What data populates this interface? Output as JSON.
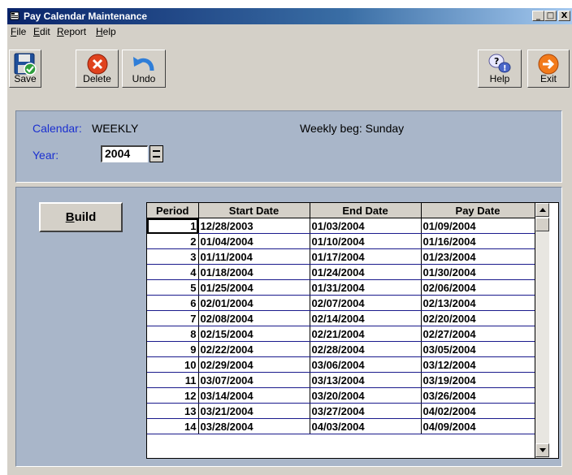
{
  "window": {
    "title": "Pay Calendar Maintenance",
    "controls": {
      "minimize": "_",
      "maximize": "□",
      "close": "X"
    }
  },
  "menu": [
    {
      "label": "File",
      "ul": "F",
      "rest": "ile"
    },
    {
      "label": "Edit",
      "ul": "E",
      "rest": "dit"
    },
    {
      "label": "Report",
      "ul": "R",
      "rest": "eport"
    },
    {
      "label": "Help",
      "ul": "H",
      "rest": "elp"
    }
  ],
  "toolbar": {
    "save": "Save",
    "delete": "Delete",
    "undo": "Undo",
    "help": "Help",
    "exit": "Exit"
  },
  "calendar": {
    "calendar_label": "Calendar:",
    "calendar_value": "WEEKLY",
    "weekly_beg": "Weekly beg: Sunday",
    "year_label": "Year:",
    "year_value": "2004"
  },
  "build_button": {
    "ul": "B",
    "rest": "uild"
  },
  "grid": {
    "columns": [
      "Period",
      "Start Date",
      "End Date",
      "Pay Date"
    ],
    "rows": [
      [
        "1",
        "12/28/2003",
        "01/03/2004",
        "01/09/2004"
      ],
      [
        "2",
        "01/04/2004",
        "01/10/2004",
        "01/16/2004"
      ],
      [
        "3",
        "01/11/2004",
        "01/17/2004",
        "01/23/2004"
      ],
      [
        "4",
        "01/18/2004",
        "01/24/2004",
        "01/30/2004"
      ],
      [
        "5",
        "01/25/2004",
        "01/31/2004",
        "02/06/2004"
      ],
      [
        "6",
        "02/01/2004",
        "02/07/2004",
        "02/13/2004"
      ],
      [
        "7",
        "02/08/2004",
        "02/14/2004",
        "02/20/2004"
      ],
      [
        "8",
        "02/15/2004",
        "02/21/2004",
        "02/27/2004"
      ],
      [
        "9",
        "02/22/2004",
        "02/28/2004",
        "03/05/2004"
      ],
      [
        "10",
        "02/29/2004",
        "03/06/2004",
        "03/12/2004"
      ],
      [
        "11",
        "03/07/2004",
        "03/13/2004",
        "03/19/2004"
      ],
      [
        "12",
        "03/14/2004",
        "03/20/2004",
        "03/26/2004"
      ],
      [
        "13",
        "03/21/2004",
        "03/27/2004",
        "04/02/2004"
      ],
      [
        "14",
        "03/28/2004",
        "04/03/2004",
        "04/09/2004"
      ]
    ]
  }
}
